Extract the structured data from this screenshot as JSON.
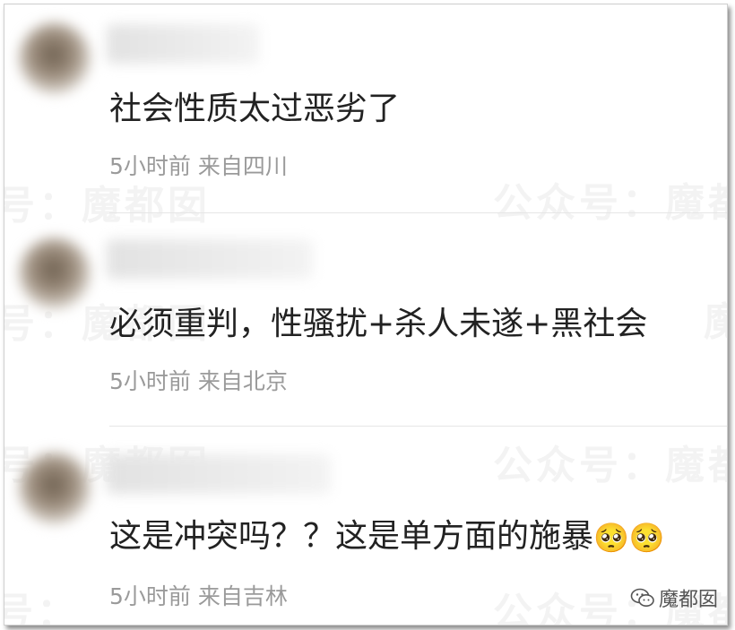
{
  "watermark": {
    "text_main": "公众号：魔都囡",
    "text_left": "号：魔都囡",
    "text_right": "魔",
    "text_side": "众号："
  },
  "comments": [
    {
      "text": "社会性质太过恶劣了",
      "meta": "5小时前 来自四川"
    },
    {
      "text": "必须重判，性骚扰+杀人未遂+黑社会",
      "meta": "5小时前 来自北京"
    },
    {
      "text": "这是冲突吗？？这是单方面的施暴",
      "emojis": [
        "🥺",
        "🥺"
      ],
      "meta": "5小时前 来自吉林"
    }
  ],
  "brand": {
    "icon": "wechat-icon",
    "label": "魔都囡"
  }
}
